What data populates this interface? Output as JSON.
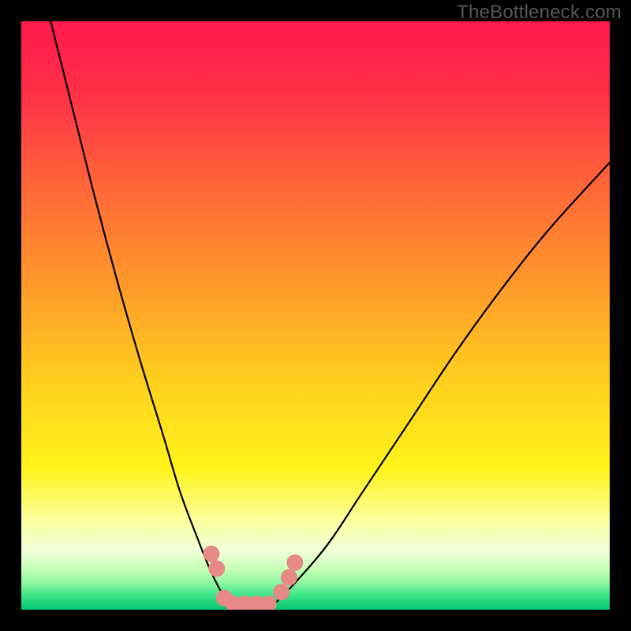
{
  "watermark": "TheBottleneck.com",
  "chart_data": {
    "type": "line",
    "title": "",
    "xlabel": "",
    "ylabel": "",
    "xlim": [
      0,
      100
    ],
    "ylim": [
      0,
      100
    ],
    "note": "Bottleneck V-curve plot. Y-axis inverted visually: 0 (best / green) at bottom, 100 (worst / red) at top. Background is a vertical gradient from red (top) through orange/yellow to a thin green band at the bottom. Two black curves descend to a flat minimum near x ≈ 35–42 at y ≈ 0 then rise again. Pink rounded markers sit on the curves near the trough.",
    "series": [
      {
        "name": "left-curve",
        "x": [
          5,
          8,
          12,
          16,
          20,
          24,
          27,
          30,
          32,
          34,
          36
        ],
        "y": [
          100,
          88,
          72,
          57,
          43,
          30,
          20,
          12,
          7,
          3,
          0
        ]
      },
      {
        "name": "flat-trough",
        "x": [
          36,
          42
        ],
        "y": [
          0,
          0
        ]
      },
      {
        "name": "right-curve",
        "x": [
          42,
          46,
          52,
          58,
          66,
          74,
          82,
          90,
          100
        ],
        "y": [
          0,
          4,
          11,
          20,
          32,
          44,
          55,
          65,
          76
        ]
      }
    ],
    "markers": {
      "name": "highlight-points",
      "color": "#e78a86",
      "points": [
        {
          "x": 32.3,
          "y": 9.5
        },
        {
          "x": 33.2,
          "y": 7.0
        },
        {
          "x": 34.5,
          "y": 2.0
        },
        {
          "x": 36.0,
          "y": 1.0
        },
        {
          "x": 38.0,
          "y": 1.0
        },
        {
          "x": 40.0,
          "y": 1.0
        },
        {
          "x": 42.0,
          "y": 1.0
        },
        {
          "x": 44.2,
          "y": 3.0
        },
        {
          "x": 45.5,
          "y": 5.5
        },
        {
          "x": 46.5,
          "y": 8.0
        }
      ]
    },
    "gradient_stops": [
      {
        "pos": 0.0,
        "color": "#ff1a4c"
      },
      {
        "pos": 0.12,
        "color": "#ff2f47"
      },
      {
        "pos": 0.28,
        "color": "#ff6638"
      },
      {
        "pos": 0.45,
        "color": "#ff9a2a"
      },
      {
        "pos": 0.62,
        "color": "#ffd21e"
      },
      {
        "pos": 0.76,
        "color": "#fff31a"
      },
      {
        "pos": 0.85,
        "color": "#fbffa0"
      },
      {
        "pos": 0.9,
        "color": "#f0ffd8"
      },
      {
        "pos": 0.93,
        "color": "#c8ffb8"
      },
      {
        "pos": 0.955,
        "color": "#8cf7a0"
      },
      {
        "pos": 0.975,
        "color": "#3de587"
      },
      {
        "pos": 1.0,
        "color": "#06c876"
      }
    ]
  }
}
